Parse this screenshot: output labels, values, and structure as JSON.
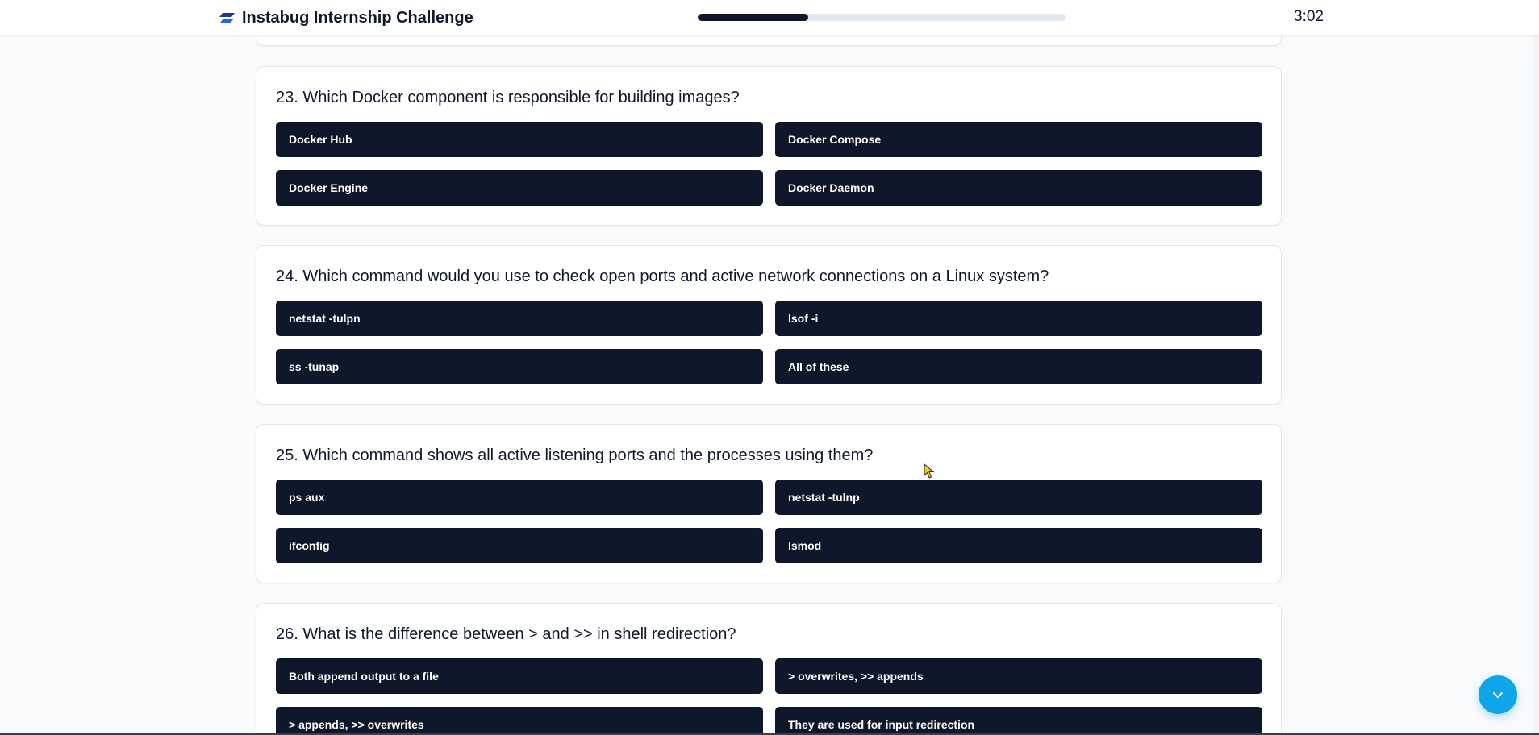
{
  "header": {
    "title": "Instabug Internship Challenge",
    "progress_fraction": 0.3,
    "timer": "3:02"
  },
  "questions": [
    {
      "title": "23. Which Docker component is responsible for building images?",
      "options": [
        "Docker Hub",
        "Docker Compose",
        "Docker Engine",
        "Docker Daemon"
      ]
    },
    {
      "title": "24. Which command would you use to check open ports and active network connections on a Linux system?",
      "options": [
        "netstat -tulpn",
        "lsof -i",
        "ss -tunap",
        "All of these"
      ]
    },
    {
      "title": "25. Which command shows all active listening ports and the processes using them?",
      "options": [
        "ps aux",
        "netstat -tulnp",
        "ifconfig",
        "lsmod"
      ]
    },
    {
      "title": "26. What is the difference between > and >> in shell redirection?",
      "options": [
        "Both append output to a file",
        "> overwrites, >> appends",
        "> appends, >> overwrites",
        "They are used for input redirection"
      ]
    }
  ],
  "colors": {
    "option_bg": "#0f172a",
    "accent": "#0ea5e9",
    "progress_fill": "#0f172a",
    "progress_track": "#e2e8f0"
  },
  "icons": {
    "logo": "instabug-logo-icon",
    "scroll": "chevron-down-icon"
  }
}
